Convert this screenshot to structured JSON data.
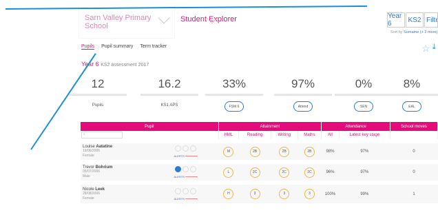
{
  "header": {
    "school": "Sarn Valley Primary School",
    "explorer": "Student Explorer",
    "year_pill": "Year 6",
    "ks_pill": "KS2",
    "filters": "Filters",
    "sort_prefix": "Sort by",
    "sort_value": "Surname (+ 2 more)"
  },
  "tabs": [
    "Pupils",
    "Pupil summary",
    "Term tracker"
  ],
  "title": {
    "year": "Year 6",
    "sub": "KS2 assessment 2017"
  },
  "stats": [
    {
      "num": "12",
      "label": "Pupils"
    },
    {
      "num": "16.2",
      "label": "KS1 APS"
    },
    {
      "num": "33%",
      "label": "FSM 6"
    },
    {
      "num": "97%",
      "label": "Attend"
    },
    {
      "num": "0%",
      "label": "SEN"
    },
    {
      "num": "8%",
      "label": "EAL"
    }
  ],
  "table": {
    "groups": [
      "Pupil",
      "Attainment",
      "Attendance",
      "School moves"
    ],
    "sub": [
      "HML",
      "Reading",
      "Writing",
      "Maths",
      "All",
      "Latest key stage"
    ],
    "search_placeholder": "",
    "rows": [
      {
        "first": "Louise",
        "last": "Aatatine",
        "dob": "19/06/2006",
        "gender": "Female",
        "hml": "M",
        "r": "2B",
        "w": "2B",
        "m": "2B",
        "all": "98%",
        "latest": "97%",
        "moves": "0"
      },
      {
        "first": "Trevor",
        "last": "Bohrium",
        "dob": "05/07/2006",
        "gender": "Male",
        "hml": "L",
        "r": "2C",
        "w": "2C",
        "m": "2C",
        "all": "96%",
        "latest": "97%",
        "moves": "0"
      },
      {
        "first": "Nicole",
        "last": "Leek",
        "dob": "28/08/2006",
        "gender": "Female",
        "hml": "H",
        "r": "3",
        "w": "3",
        "m": "3",
        "all": "100%",
        "latest": "99%",
        "moves": "1"
      }
    ],
    "alerts_label": "ALERTS"
  }
}
